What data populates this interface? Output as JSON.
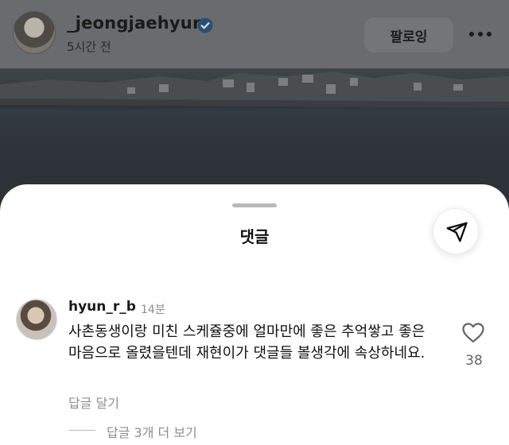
{
  "post": {
    "author": "_jeongjaehyun",
    "time_ago": "5시간 전",
    "follow_label": "팔로잉",
    "more_label": "•••"
  },
  "comments_sheet": {
    "title": "댓글",
    "comment": {
      "username": "hyun_r_b",
      "time": "14분",
      "text": "사촌동생이랑 미친 스케쥴중에 얼마만에 좋은 추억쌓고 좋은 마음으로 올렸을텐데 재현이가 댓글들 볼생각에 속상하네요.",
      "reply_label": "답글 달기",
      "like_count": "38",
      "view_replies_label": "답글 3개 더 보기"
    }
  },
  "icons": {
    "verified": "verified-badge-icon",
    "share": "send-icon",
    "like": "heart-outline-icon"
  },
  "colors": {
    "verified_blue": "#3897f0",
    "dim_overlay": "#6a6b6e",
    "sheet_bg": "#ffffff",
    "secondary_text": "#8e8e8e"
  }
}
